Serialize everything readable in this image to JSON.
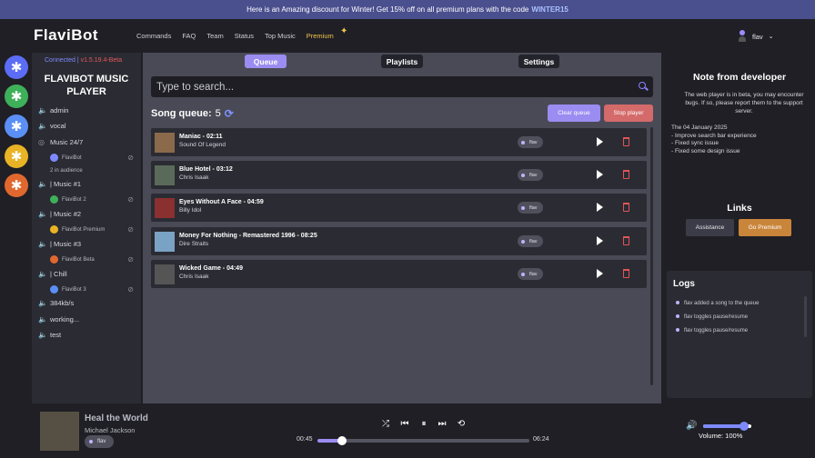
{
  "banner": {
    "text": "Here is an Amazing discount for Winter! Get 15% off on all premium plans with the code",
    "code": "WINTER15"
  },
  "nav": {
    "logo": "FlaviBot",
    "links": [
      "Commands",
      "FAQ",
      "Team",
      "Status",
      "Top Music",
      "Premium"
    ],
    "user": "flav"
  },
  "sidebar": {
    "connected": "Connected",
    "sep": "|",
    "version": "v1.5.19.4-Beta",
    "title": "FLAVIBOT MUSIC PLAYER",
    "channels": [
      {
        "name": "admin",
        "icon": "speaker-icon"
      },
      {
        "name": "vocal",
        "icon": "speaker-icon"
      },
      {
        "name": "Music 24/7",
        "icon": "stage-icon"
      },
      {
        "name": "| Music #1",
        "icon": "speaker-icon"
      },
      {
        "name": "| Music #2",
        "icon": "speaker-icon"
      },
      {
        "name": "| Music #3",
        "icon": "speaker-icon"
      },
      {
        "name": "| Chill",
        "icon": "speaker-icon"
      },
      {
        "name": "384kb/s",
        "icon": "speaker-icon"
      },
      {
        "name": "working...",
        "icon": "speaker-icon"
      },
      {
        "name": "test",
        "icon": "speaker-icon"
      }
    ],
    "bots": [
      "FlaviBot",
      "FlaviBot 2",
      "FlaviBot Premium",
      "FlaviBot Beta",
      "FlaviBot 3"
    ],
    "audience": "2 in audience",
    "server_colors": [
      "#5b6df5",
      "#3fb05a",
      "#5b8ff5",
      "#e8b324",
      "#e0682e"
    ],
    "bot_colors": [
      "#7d8aff",
      "#3fb05a",
      "#e8b324",
      "#e0682e",
      "#5b8ff5"
    ]
  },
  "tabs": {
    "queue": "Queue",
    "playlists": "Playlists",
    "settings": "Settings"
  },
  "search": {
    "placeholder": "Type to search..."
  },
  "queue": {
    "label": "Song queue:",
    "count": "5",
    "clear_label": "Clear queue",
    "stop_label": "Stop player",
    "songs": [
      {
        "title": "Maniac - 02:11",
        "artist": "Sound Of Legend",
        "user": "flav"
      },
      {
        "title": "Blue Hotel - 03:12",
        "artist": "Chris Isaak",
        "user": "flav"
      },
      {
        "title": "Eyes Without A Face - 04:59",
        "artist": "Billy Idol",
        "user": "flav"
      },
      {
        "title": "Money For Nothing - Remastered 1996 - 08:25",
        "artist": "Dire Straits",
        "user": "flav"
      },
      {
        "title": "Wicked Game - 04:49",
        "artist": "Chris Isaak",
        "user": "flav"
      }
    ]
  },
  "note": {
    "title": "Note from developer",
    "intro": "The web player is in beta, you may encounter bugs. If so, please report them to the support server.",
    "lines": [
      "The 04 January 2025",
      "- Improve search bar experience",
      "- Fixed sync issue",
      "- Fixed some design issue"
    ]
  },
  "links": {
    "title": "Links",
    "assistance": "Assistance",
    "premium": "Go Premium"
  },
  "logs": {
    "title": "Logs",
    "items": [
      "flav added a song to the queue",
      "flav toggles pause/resume",
      "flav toggles pause/resume"
    ]
  },
  "player": {
    "title": "Heal the World",
    "artist": "Michael Jackson",
    "user": "flav",
    "elapsed": "00:45",
    "duration": "06:24",
    "progress": 0.117,
    "volume_label": "Volume: 100%",
    "volume": 0.85
  }
}
